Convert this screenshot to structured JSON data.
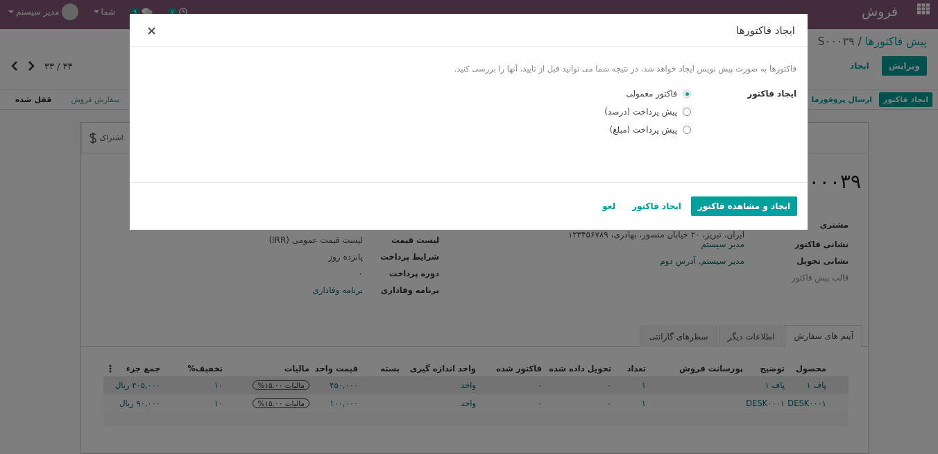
{
  "navbar": {
    "app": "فروش",
    "activity_count": "۷",
    "messages_count": "۹",
    "company": "شما",
    "user": "مدیر سیستم"
  },
  "breadcrumb": {
    "parent": "پیش فاکتورها",
    "separator": "/",
    "current": "S۰۰۰۳۹"
  },
  "actions": [
    {
      "label": "ویرایش",
      "kind": "primary"
    },
    {
      "label": "ایجاد",
      "kind": "link"
    }
  ],
  "pager": "۳۳ / ۳۳",
  "status_buttons": [
    {
      "label": "ایجاد فاکتور",
      "kind": "primary"
    },
    {
      "label": "ارسال پروفورما",
      "kind": "link"
    }
  ],
  "stages": [
    {
      "label": "سفارش فروش",
      "selected": false
    },
    {
      "label": "قفل شده",
      "selected": true
    }
  ],
  "smart_button": "اشتراک",
  "form": {
    "title": "۰۰۰۳۹",
    "right_fields": [
      {
        "label": "مشتری",
        "value": "ایران، تبریز، ۲۰ خیابان منصور، بهادری، ۱۲۳۴۵۶۷۸۹",
        "kind": "text"
      },
      {
        "label": "نشانی فاکتور",
        "value": "مدیر سیستم",
        "kind": "link"
      },
      {
        "label": "نشانی تحویل",
        "value": "مدیر سیستم, آدرس دوم",
        "kind": "link"
      },
      {
        "label": "قالب پیش فاکتور",
        "kind": "muted"
      }
    ],
    "left_fields": [
      {
        "label": "لیست قیمت",
        "value": "لیست قیمت عمومی (IRR)",
        "kind": "text"
      },
      {
        "label": "شرایط پرداخت",
        "value": "پانزده روز",
        "kind": "text"
      },
      {
        "label": "دوره پرداخت",
        "value": "۰",
        "kind": "text"
      },
      {
        "label": "برنامه وفاداری",
        "value": "برنامه وفاداری",
        "kind": "link"
      }
    ]
  },
  "tabs": [
    {
      "label": "آیتم های سفارش",
      "selected": true
    },
    {
      "label": "اطلاعات دیگر",
      "selected": false
    },
    {
      "label": "سطرهای گارانتی",
      "selected": false
    }
  ],
  "table": {
    "columns": [
      "محصول",
      "توضیح",
      "پورسانت فروش",
      "تعداد",
      "تحویل داده شده",
      "فاکتور شده",
      "واحد اندازه گیری",
      "بسته",
      "قیمت واحد",
      "مالیات",
      "تخفیف%",
      "جمع جزء"
    ],
    "rows": [
      {
        "product": "پاف ۱",
        "description": "پاف ۱",
        "quantity": "۱",
        "delivered": "۰",
        "invoiced": "۰",
        "uom": "واحد",
        "unit_price": "۴۵۰,۰۰۰",
        "tax": "مالیات ۱۵.۰۰%",
        "discount": "۱۰",
        "subtotal": "۴۰۵,۰۰۰ ریال"
      },
      {
        "product": "DESK۰۰۰۱",
        "description": "DESK۰۰۰۱",
        "quantity": "۱",
        "delivered": "۰",
        "invoiced": "۰",
        "uom": "واحد",
        "unit_price": "۱۰۰,۰۰۰",
        "tax": "مالیات ۱۵.۰۰%",
        "discount": "۱۰",
        "subtotal": "۹۰,۰۰۰ ریال"
      }
    ]
  },
  "dialog": {
    "title": "ایجاد فاکتورها",
    "close": "×",
    "description": "فاکتورها به صورت پیش نویس ایجاد خواهد شد، در نتیجه شما می توانید قبل از تایید، آنها را بررسی کنید.",
    "field_label": "ایجاد فاکتور",
    "options": [
      {
        "label": "فاکتور معمولی",
        "selected": true
      },
      {
        "label": "پیش پرداخت (درصد)",
        "selected": false
      },
      {
        "label": "پیش پرداخت (مبلغ)",
        "selected": false
      }
    ],
    "buttons": [
      {
        "label": "ایجاد و مشاهده فاکتور",
        "kind": "primary"
      },
      {
        "label": "ایجاد فاکتور",
        "kind": "link"
      },
      {
        "label": "لغو",
        "kind": "link"
      }
    ]
  }
}
